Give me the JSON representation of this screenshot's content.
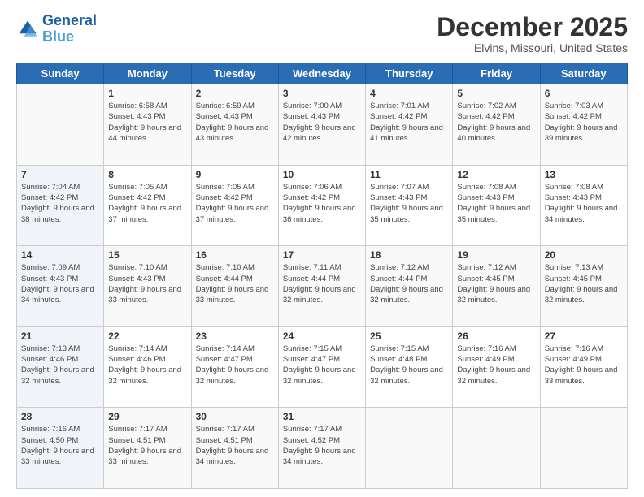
{
  "header": {
    "logo_line1": "General",
    "logo_line2": "Blue",
    "title": "December 2025",
    "subtitle": "Elvins, Missouri, United States"
  },
  "days_of_week": [
    "Sunday",
    "Monday",
    "Tuesday",
    "Wednesday",
    "Thursday",
    "Friday",
    "Saturday"
  ],
  "weeks": [
    [
      {
        "day": "",
        "sunrise": "",
        "sunset": "",
        "daylight": ""
      },
      {
        "day": "1",
        "sunrise": "Sunrise: 6:58 AM",
        "sunset": "Sunset: 4:43 PM",
        "daylight": "Daylight: 9 hours and 44 minutes."
      },
      {
        "day": "2",
        "sunrise": "Sunrise: 6:59 AM",
        "sunset": "Sunset: 4:43 PM",
        "daylight": "Daylight: 9 hours and 43 minutes."
      },
      {
        "day": "3",
        "sunrise": "Sunrise: 7:00 AM",
        "sunset": "Sunset: 4:43 PM",
        "daylight": "Daylight: 9 hours and 42 minutes."
      },
      {
        "day": "4",
        "sunrise": "Sunrise: 7:01 AM",
        "sunset": "Sunset: 4:42 PM",
        "daylight": "Daylight: 9 hours and 41 minutes."
      },
      {
        "day": "5",
        "sunrise": "Sunrise: 7:02 AM",
        "sunset": "Sunset: 4:42 PM",
        "daylight": "Daylight: 9 hours and 40 minutes."
      },
      {
        "day": "6",
        "sunrise": "Sunrise: 7:03 AM",
        "sunset": "Sunset: 4:42 PM",
        "daylight": "Daylight: 9 hours and 39 minutes."
      }
    ],
    [
      {
        "day": "7",
        "sunrise": "Sunrise: 7:04 AM",
        "sunset": "Sunset: 4:42 PM",
        "daylight": "Daylight: 9 hours and 38 minutes."
      },
      {
        "day": "8",
        "sunrise": "Sunrise: 7:05 AM",
        "sunset": "Sunset: 4:42 PM",
        "daylight": "Daylight: 9 hours and 37 minutes."
      },
      {
        "day": "9",
        "sunrise": "Sunrise: 7:05 AM",
        "sunset": "Sunset: 4:42 PM",
        "daylight": "Daylight: 9 hours and 37 minutes."
      },
      {
        "day": "10",
        "sunrise": "Sunrise: 7:06 AM",
        "sunset": "Sunset: 4:42 PM",
        "daylight": "Daylight: 9 hours and 36 minutes."
      },
      {
        "day": "11",
        "sunrise": "Sunrise: 7:07 AM",
        "sunset": "Sunset: 4:43 PM",
        "daylight": "Daylight: 9 hours and 35 minutes."
      },
      {
        "day": "12",
        "sunrise": "Sunrise: 7:08 AM",
        "sunset": "Sunset: 4:43 PM",
        "daylight": "Daylight: 9 hours and 35 minutes."
      },
      {
        "day": "13",
        "sunrise": "Sunrise: 7:08 AM",
        "sunset": "Sunset: 4:43 PM",
        "daylight": "Daylight: 9 hours and 34 minutes."
      }
    ],
    [
      {
        "day": "14",
        "sunrise": "Sunrise: 7:09 AM",
        "sunset": "Sunset: 4:43 PM",
        "daylight": "Daylight: 9 hours and 34 minutes."
      },
      {
        "day": "15",
        "sunrise": "Sunrise: 7:10 AM",
        "sunset": "Sunset: 4:43 PM",
        "daylight": "Daylight: 9 hours and 33 minutes."
      },
      {
        "day": "16",
        "sunrise": "Sunrise: 7:10 AM",
        "sunset": "Sunset: 4:44 PM",
        "daylight": "Daylight: 9 hours and 33 minutes."
      },
      {
        "day": "17",
        "sunrise": "Sunrise: 7:11 AM",
        "sunset": "Sunset: 4:44 PM",
        "daylight": "Daylight: 9 hours and 32 minutes."
      },
      {
        "day": "18",
        "sunrise": "Sunrise: 7:12 AM",
        "sunset": "Sunset: 4:44 PM",
        "daylight": "Daylight: 9 hours and 32 minutes."
      },
      {
        "day": "19",
        "sunrise": "Sunrise: 7:12 AM",
        "sunset": "Sunset: 4:45 PM",
        "daylight": "Daylight: 9 hours and 32 minutes."
      },
      {
        "day": "20",
        "sunrise": "Sunrise: 7:13 AM",
        "sunset": "Sunset: 4:45 PM",
        "daylight": "Daylight: 9 hours and 32 minutes."
      }
    ],
    [
      {
        "day": "21",
        "sunrise": "Sunrise: 7:13 AM",
        "sunset": "Sunset: 4:46 PM",
        "daylight": "Daylight: 9 hours and 32 minutes."
      },
      {
        "day": "22",
        "sunrise": "Sunrise: 7:14 AM",
        "sunset": "Sunset: 4:46 PM",
        "daylight": "Daylight: 9 hours and 32 minutes."
      },
      {
        "day": "23",
        "sunrise": "Sunrise: 7:14 AM",
        "sunset": "Sunset: 4:47 PM",
        "daylight": "Daylight: 9 hours and 32 minutes."
      },
      {
        "day": "24",
        "sunrise": "Sunrise: 7:15 AM",
        "sunset": "Sunset: 4:47 PM",
        "daylight": "Daylight: 9 hours and 32 minutes."
      },
      {
        "day": "25",
        "sunrise": "Sunrise: 7:15 AM",
        "sunset": "Sunset: 4:48 PM",
        "daylight": "Daylight: 9 hours and 32 minutes."
      },
      {
        "day": "26",
        "sunrise": "Sunrise: 7:16 AM",
        "sunset": "Sunset: 4:49 PM",
        "daylight": "Daylight: 9 hours and 32 minutes."
      },
      {
        "day": "27",
        "sunrise": "Sunrise: 7:16 AM",
        "sunset": "Sunset: 4:49 PM",
        "daylight": "Daylight: 9 hours and 33 minutes."
      }
    ],
    [
      {
        "day": "28",
        "sunrise": "Sunrise: 7:16 AM",
        "sunset": "Sunset: 4:50 PM",
        "daylight": "Daylight: 9 hours and 33 minutes."
      },
      {
        "day": "29",
        "sunrise": "Sunrise: 7:17 AM",
        "sunset": "Sunset: 4:51 PM",
        "daylight": "Daylight: 9 hours and 33 minutes."
      },
      {
        "day": "30",
        "sunrise": "Sunrise: 7:17 AM",
        "sunset": "Sunset: 4:51 PM",
        "daylight": "Daylight: 9 hours and 34 minutes."
      },
      {
        "day": "31",
        "sunrise": "Sunrise: 7:17 AM",
        "sunset": "Sunset: 4:52 PM",
        "daylight": "Daylight: 9 hours and 34 minutes."
      },
      {
        "day": "",
        "sunrise": "",
        "sunset": "",
        "daylight": ""
      },
      {
        "day": "",
        "sunrise": "",
        "sunset": "",
        "daylight": ""
      },
      {
        "day": "",
        "sunrise": "",
        "sunset": "",
        "daylight": ""
      }
    ]
  ]
}
